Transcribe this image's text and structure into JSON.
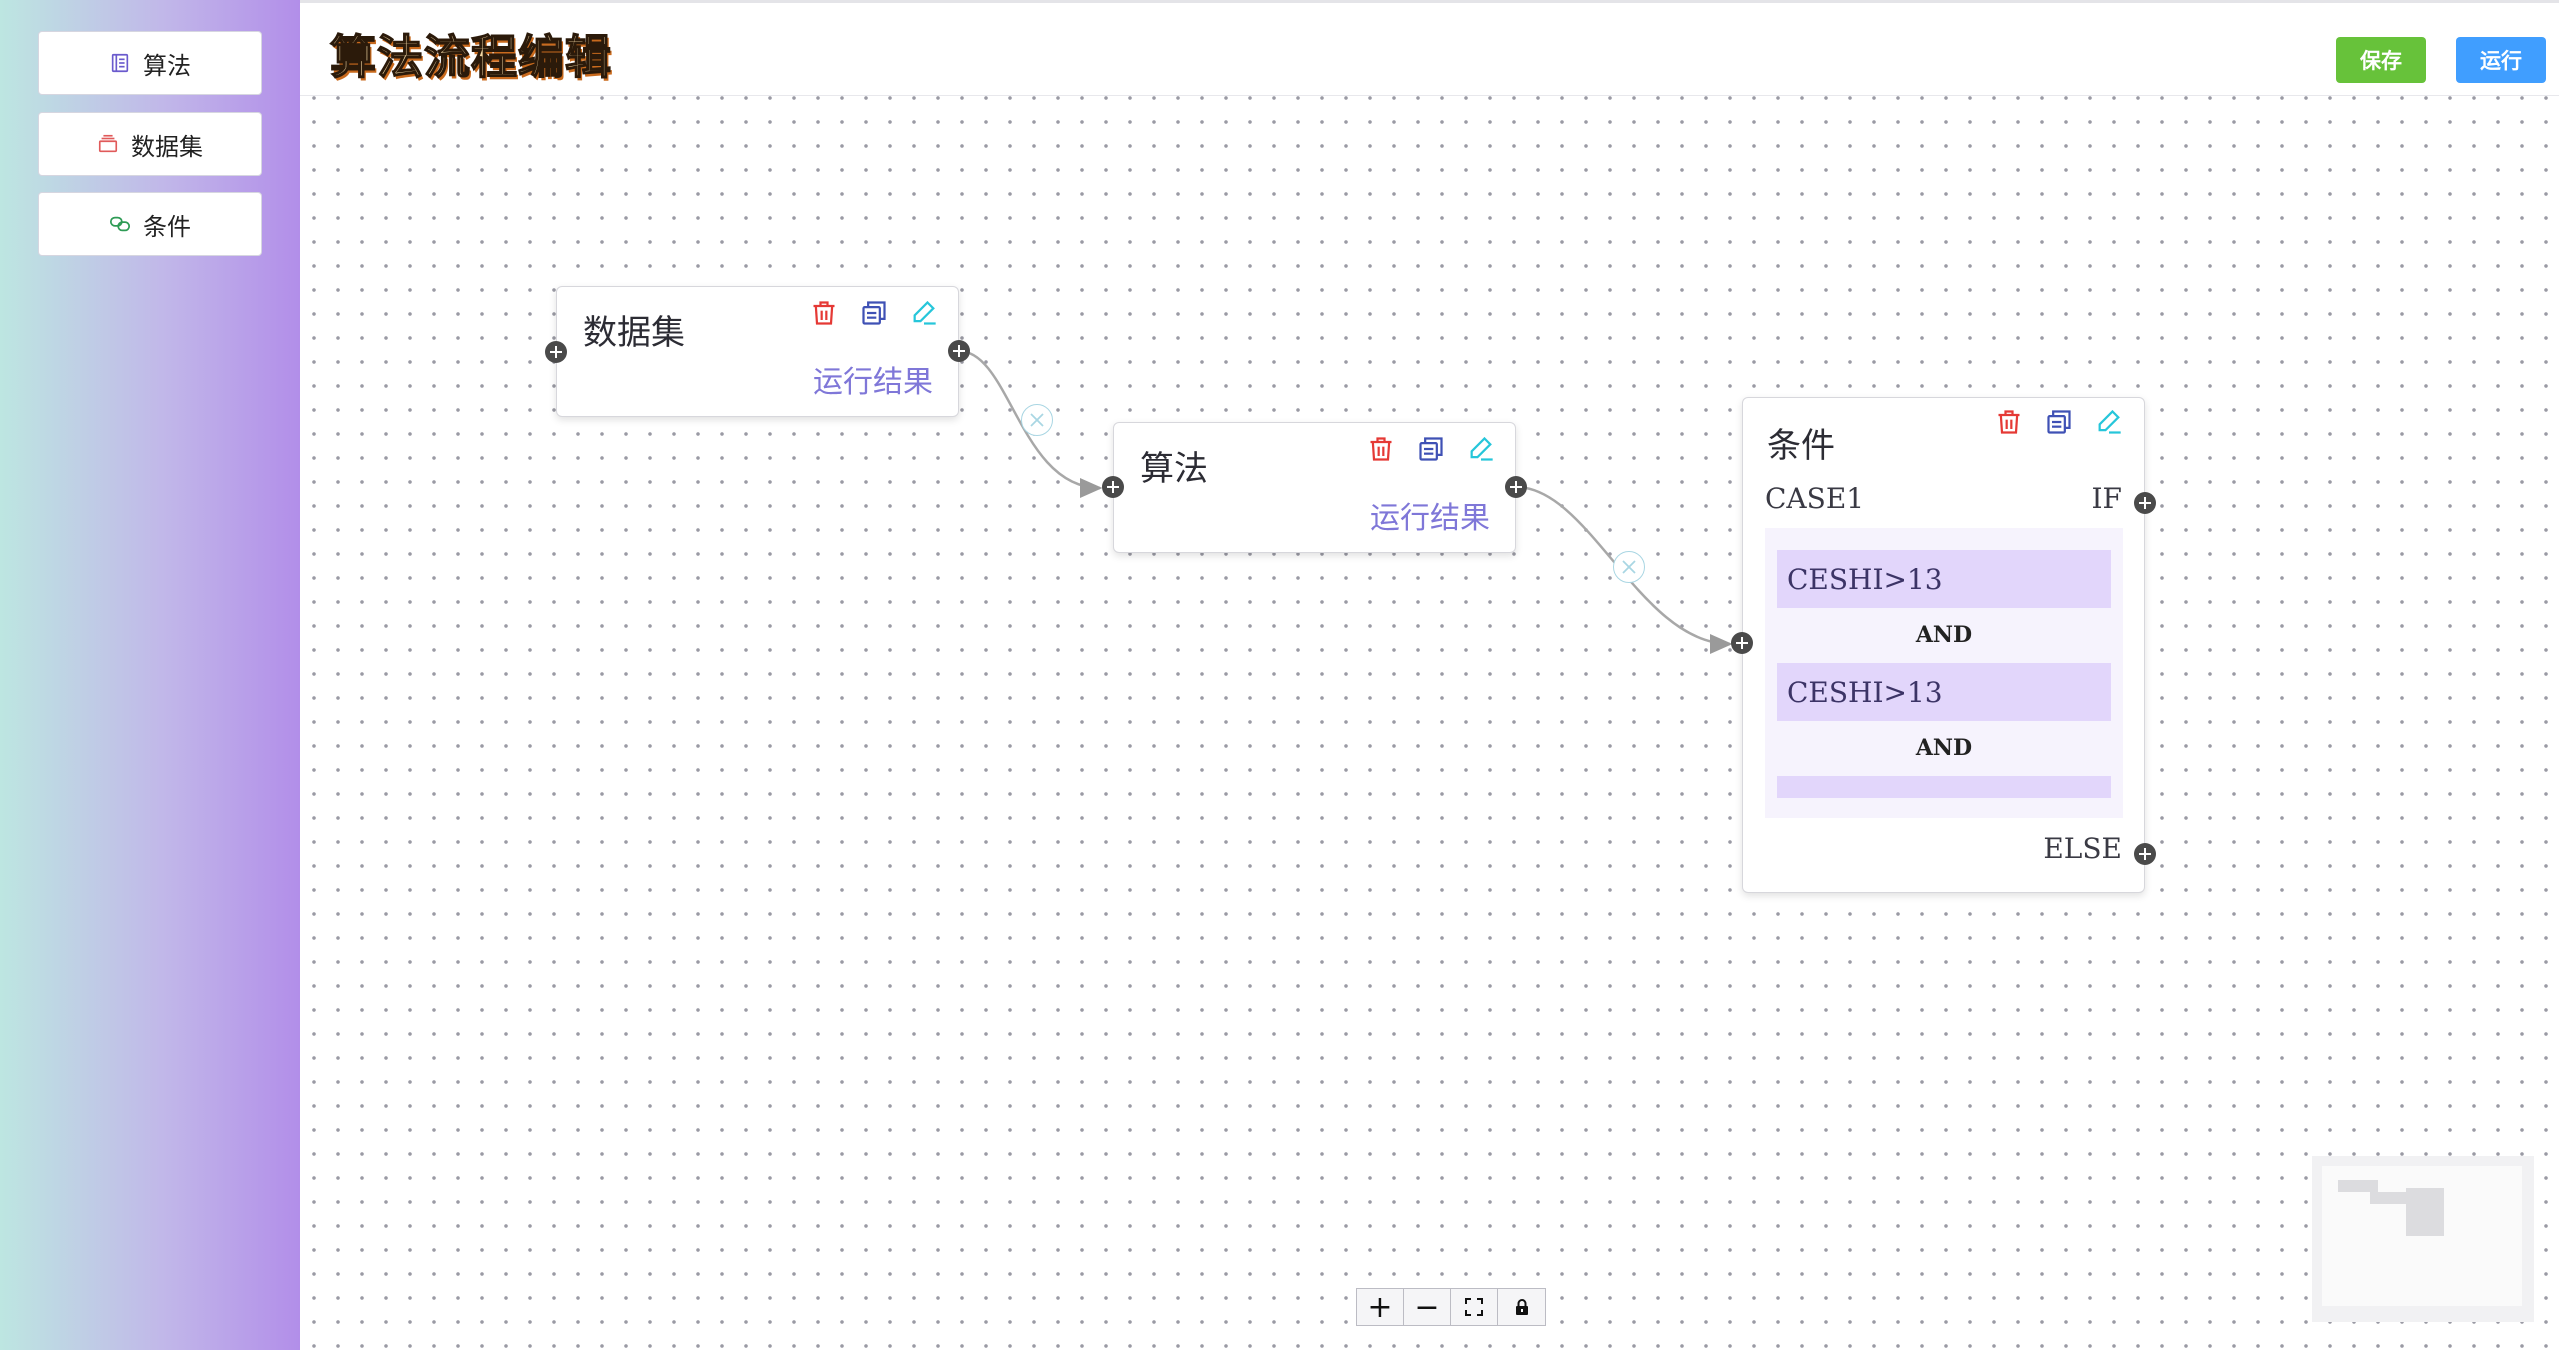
{
  "sidebar": {
    "items": [
      {
        "label": "算法",
        "icon": "document-icon",
        "color": "#6a5acd"
      },
      {
        "label": "数据集",
        "icon": "box-icon",
        "color": "#e05a5a"
      },
      {
        "label": "条件",
        "icon": "link-icon",
        "color": "#2e9b55"
      }
    ]
  },
  "header": {
    "title": "算法流程编辑",
    "save_label": "保存",
    "run_label": "运行"
  },
  "nodes": {
    "dataset": {
      "title": "数据集",
      "result": "运行结果"
    },
    "algorithm": {
      "title": "算法",
      "result": "运行结果"
    },
    "condition": {
      "title": "条件",
      "case_label": "CASE1",
      "if_label": "IF",
      "else_label": "ELSE",
      "items": [
        "CESHI>13",
        "CESHI>13",
        ""
      ],
      "connectors": [
        "AND",
        "AND"
      ]
    }
  },
  "colors": {
    "delete": "#e53935",
    "copy": "#3f51b5",
    "edit": "#26c6da",
    "save": "#67c23a",
    "run": "#409eff",
    "result_text": "#7f77d8"
  },
  "zoom_controls": {
    "zoom_in": "+",
    "zoom_out": "−"
  }
}
